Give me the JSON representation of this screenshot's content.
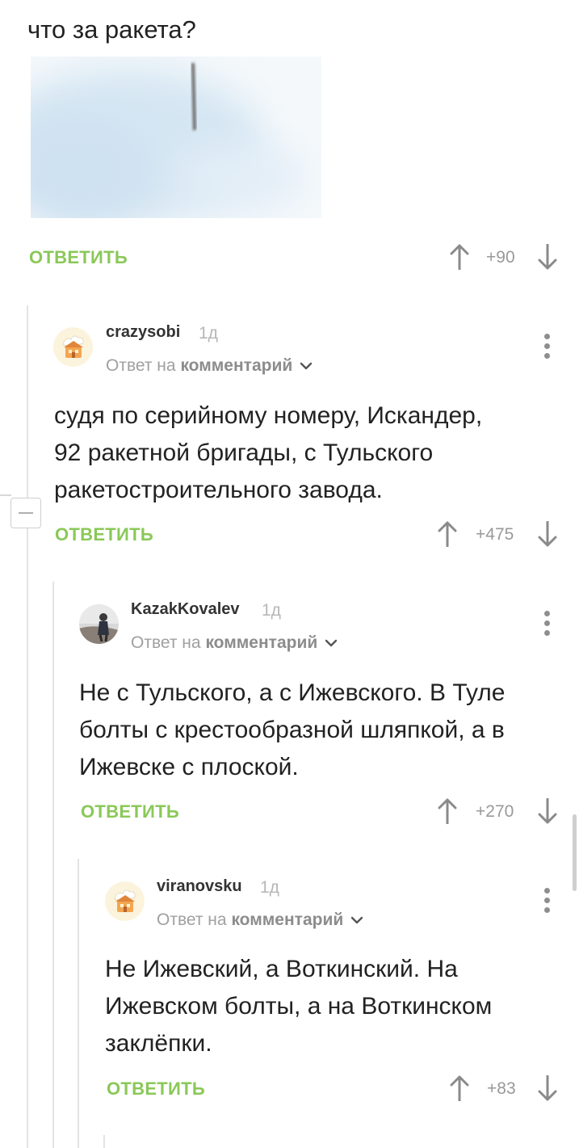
{
  "post": {
    "text": "что за ракета?",
    "reply_label": "ОТВЕТИТЬ",
    "score": "+90"
  },
  "comments": [
    {
      "username": "crazysobi",
      "age": "1д",
      "reply_to_prefix": "Ответ на",
      "reply_to_link": "комментарий",
      "text": "судя по серийному номеру, Искандер,\n92 ракетной бригады, с Тульского\nракетостроительного завода.",
      "reply_label": "ОТВЕТИТЬ",
      "score": "+475"
    },
    {
      "username": "KazakKovalev",
      "age": "1д",
      "reply_to_prefix": "Ответ на",
      "reply_to_link": "комментарий",
      "text": "Не с Тульского, а с Ижевского. В Туле\nболты с крестообразной шляпкой, а в\nИжевске с плоской.",
      "reply_label": "ОТВЕТИТЬ",
      "score": "+270"
    },
    {
      "username": "viranovsku",
      "age": "1д",
      "reply_to_prefix": "Ответ на",
      "reply_to_link": "комментарий",
      "text": "Не Ижевский, а Воткинский. На\nИжевском болты, а на Воткинском\nзаклёпки.",
      "reply_label": "ОТВЕТИТЬ",
      "score": "+83"
    }
  ],
  "icons": {
    "upvote": "arrow-up-icon",
    "downvote": "arrow-down-icon",
    "more": "kebab-menu-icon",
    "dropdown": "chevron-down-icon",
    "collapse": "minus-icon"
  },
  "colors": {
    "accent_green": "#8ac858",
    "thread_line": "#e3e3e3",
    "muted_text": "#a0a0a0"
  }
}
